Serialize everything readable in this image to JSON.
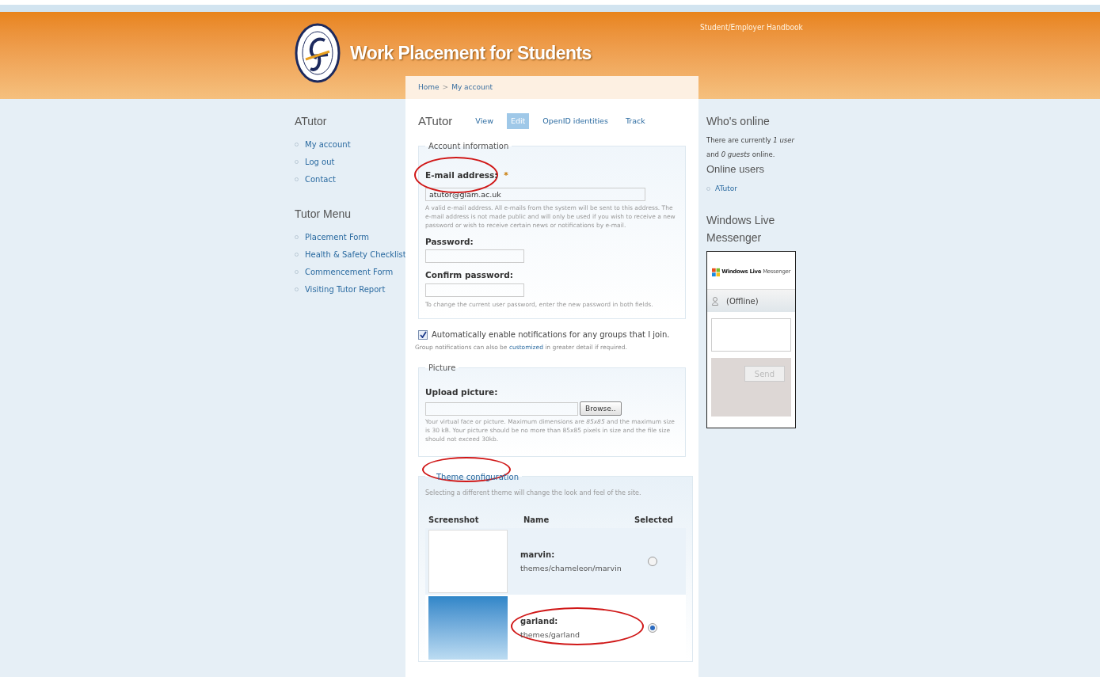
{
  "header": {
    "site_title": "Work Placement for Students",
    "top_link": "Student/Employer Handbook",
    "breadcrumb": [
      "Home",
      "My account"
    ],
    "breadcrumb_separator": ">"
  },
  "left_sidebar": [
    {
      "title": "ATutor",
      "items": [
        "My account",
        "Log out",
        "Contact"
      ]
    },
    {
      "title": "Tutor Menu",
      "items": [
        "Placement Form",
        "Health & Safety Checklist",
        "Commencement Form",
        "Visiting Tutor Report"
      ]
    }
  ],
  "main": {
    "title": "ATutor",
    "tabs": [
      {
        "label": "View",
        "selected": false
      },
      {
        "label": "Edit",
        "selected": true
      },
      {
        "label": "OpenID identities",
        "selected": false
      },
      {
        "label": "Track",
        "selected": false
      }
    ],
    "account": {
      "legend": "Account information",
      "email": {
        "label": "E-mail address:",
        "required_mark": "*",
        "value": "atutor@glam.ac.uk",
        "help": "A valid e-mail address. All e-mails from the system will be sent to this address. The e-mail address is not made public and will only be used if you wish to receive a new password or wish to receive certain news or notifications by e-mail.",
        "highlighted": true
      },
      "password": {
        "label": "Password:"
      },
      "confirm": {
        "label": "Confirm password:",
        "help": "To change the current user password, enter the new password in both fields."
      }
    },
    "notifications": {
      "label": "Automatically enable notifications for any groups that I join.",
      "checked": true,
      "help_before": "Group notifications can also be",
      "help_link": "customized",
      "help_after": "in greater detail if required."
    },
    "picture": {
      "legend": "Picture",
      "label": "Upload picture:",
      "button": "Browse..",
      "help": "Your virtual face or picture. Maximum dimensions are *85x85* and the maximum size is 30 kB. Your picture should be no more than 85x85 pixels in size and the file size should not exceed 30kb."
    },
    "theme": {
      "legend": "Theme configuration",
      "legend_highlighted": true,
      "description": "Selecting a different theme will change the look and feel of the site.",
      "columns": [
        "Screenshot",
        "Name",
        "Selected"
      ],
      "rows": [
        {
          "name": "marvin:",
          "path": "themes/chameleon/marvin",
          "selected": false,
          "highlighted": false,
          "kind": "light"
        },
        {
          "name": "garland:",
          "path": "themes/garland",
          "selected": true,
          "highlighted": true,
          "kind": "blue"
        }
      ]
    }
  },
  "right_sidebar": {
    "whos_online": {
      "title": "Who's online",
      "text": "There are currently *1 user* and *0 guests* online.",
      "subtitle": "Online users",
      "users": [
        "ATutor"
      ]
    },
    "messenger": {
      "title": "Windows Live Messenger",
      "logo_bold": "Windows Live",
      "logo_light": "Messenger",
      "status": "(Offline)",
      "send": "Send"
    }
  }
}
